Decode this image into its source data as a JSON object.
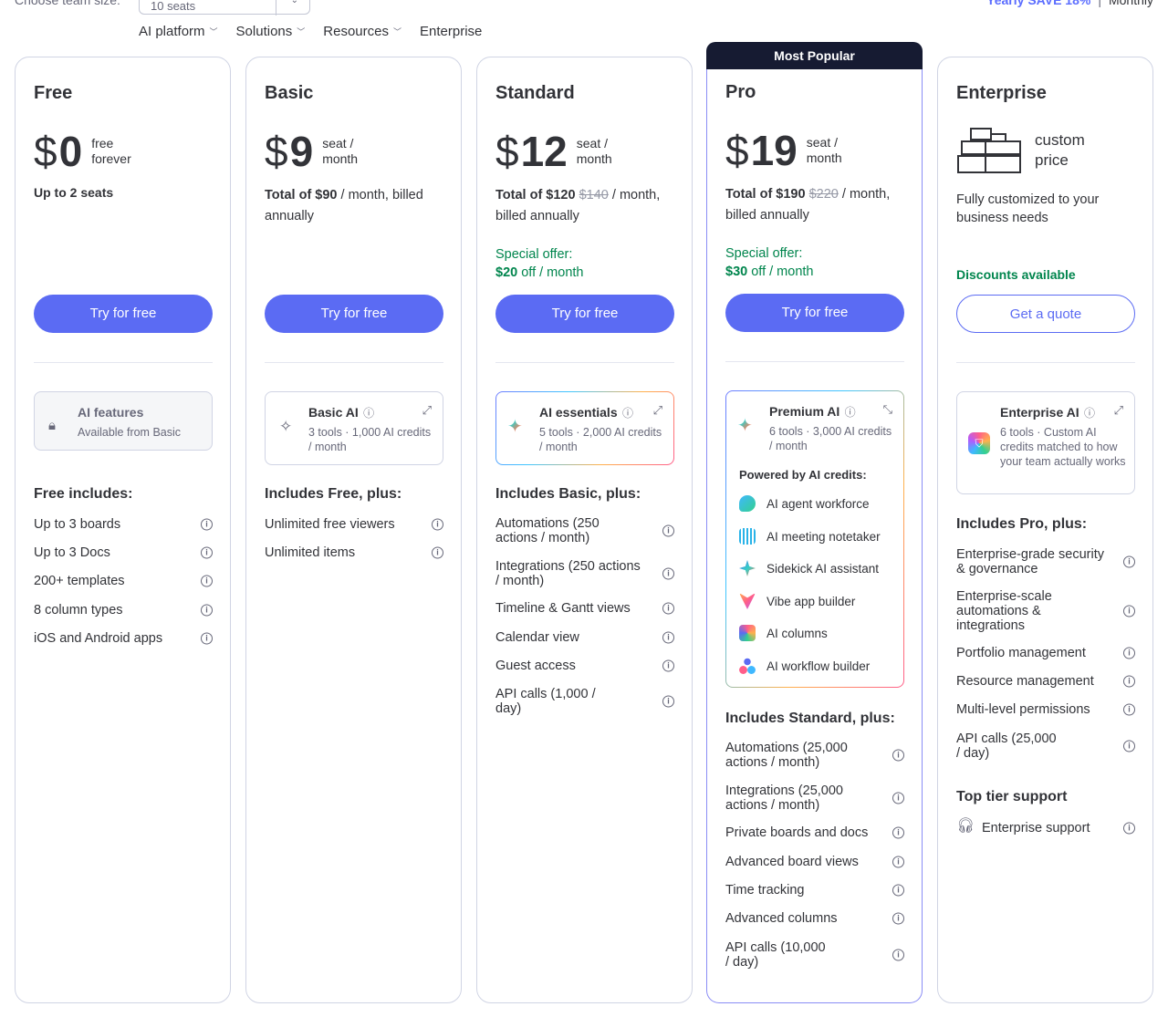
{
  "top": {
    "team_label": "Choose team size:",
    "team_value": "10 seats",
    "billing_yearly": "Yearly SAVE 18%",
    "billing_sep": "|",
    "billing_monthly": "Monthly"
  },
  "nav": [
    "AI platform",
    "Solutions",
    "Resources",
    "Enterprise"
  ],
  "plans": {
    "free": {
      "name": "Free",
      "dollar": "$",
      "amount": "0",
      "unit1": "free",
      "unit2": "forever",
      "seats": "Up to 2 seats",
      "cta": "Try for free",
      "ai_title": "AI features",
      "ai_sub": "Available from Basic",
      "includes_title": "Free includes:",
      "features": [
        "Up to 3 boards",
        "Up to 3 Docs",
        "200+ templates",
        "8 column types",
        "iOS and Android apps"
      ]
    },
    "basic": {
      "name": "Basic",
      "dollar": "$",
      "amount": "9",
      "unit1": "seat /",
      "unit2": "month",
      "total_a": "Total of $90",
      "total_b": " / month, billed annually",
      "cta": "Try for free",
      "ai_title": "Basic AI",
      "ai_sub": "3 tools · 1,000 AI credits / month",
      "includes_title": "Includes Free, plus:",
      "features": [
        "Unlimited free viewers",
        "Unlimited items"
      ]
    },
    "standard": {
      "name": "Standard",
      "dollar": "$",
      "amount": "12",
      "unit1": "seat /",
      "unit2": "month",
      "total_a": "Total of $120",
      "total_strike": "$140",
      "total_b": " / month, billed annually",
      "offer_label": "Special offer:",
      "offer_amount": "$20",
      "offer_rest": " off / month",
      "cta": "Try for free",
      "ai_title": "AI essentials",
      "ai_sub": "5 tools · 2,000 AI credits / month",
      "includes_title": "Includes Basic, plus:",
      "features": [
        "Automations (250 actions / month)",
        "Integrations (250 actions / month)",
        "Timeline & Gantt views",
        "Calendar view",
        "Guest access",
        "API calls (1,000 / day)"
      ]
    },
    "pro": {
      "banner": "Most Popular",
      "name": "Pro",
      "dollar": "$",
      "amount": "19",
      "unit1": "seat /",
      "unit2": "month",
      "total_a": "Total of $190",
      "total_strike": "$220",
      "total_b": " / month, billed annually",
      "offer_label": "Special offer:",
      "offer_amount": "$30",
      "offer_rest": " off / month",
      "cta": "Try for free",
      "ai_title": "Premium AI",
      "ai_sub": "6 tools · 3,000 AI credits / month",
      "powered": "Powered by AI credits:",
      "ai_features": [
        "AI agent workforce",
        "AI meeting notetaker",
        "Sidekick AI assistant",
        "Vibe app builder",
        "AI columns",
        "AI workflow builder"
      ],
      "includes_title": "Includes Standard, plus:",
      "features": [
        "Automations (25,000 actions / month)",
        "Integrations (25,000 actions / month)",
        "Private boards and docs",
        "Advanced board views",
        "Time tracking",
        "Advanced columns",
        "API calls (10,000 / day)"
      ]
    },
    "enterprise": {
      "name": "Enterprise",
      "custom1": "custom",
      "custom2": "price",
      "desc": "Fully customized to your business needs",
      "discounts": "Discounts available",
      "cta": "Get a quote",
      "ai_title": "Enterprise AI",
      "ai_sub": "6 tools · Custom AI credits matched to how your team actually works",
      "includes_title": "Includes Pro, plus:",
      "features": [
        "Enterprise-grade security & governance",
        "Enterprise-scale automations & integrations",
        "Portfolio management",
        "Resource management",
        "Multi-level permissions",
        "API calls (25,000 / day)"
      ],
      "support_title": "Top tier support",
      "support_item": "Enterprise support"
    }
  },
  "colors": {
    "accent": "#5b6bf3",
    "green": "#00854d",
    "banner": "#161b32"
  }
}
